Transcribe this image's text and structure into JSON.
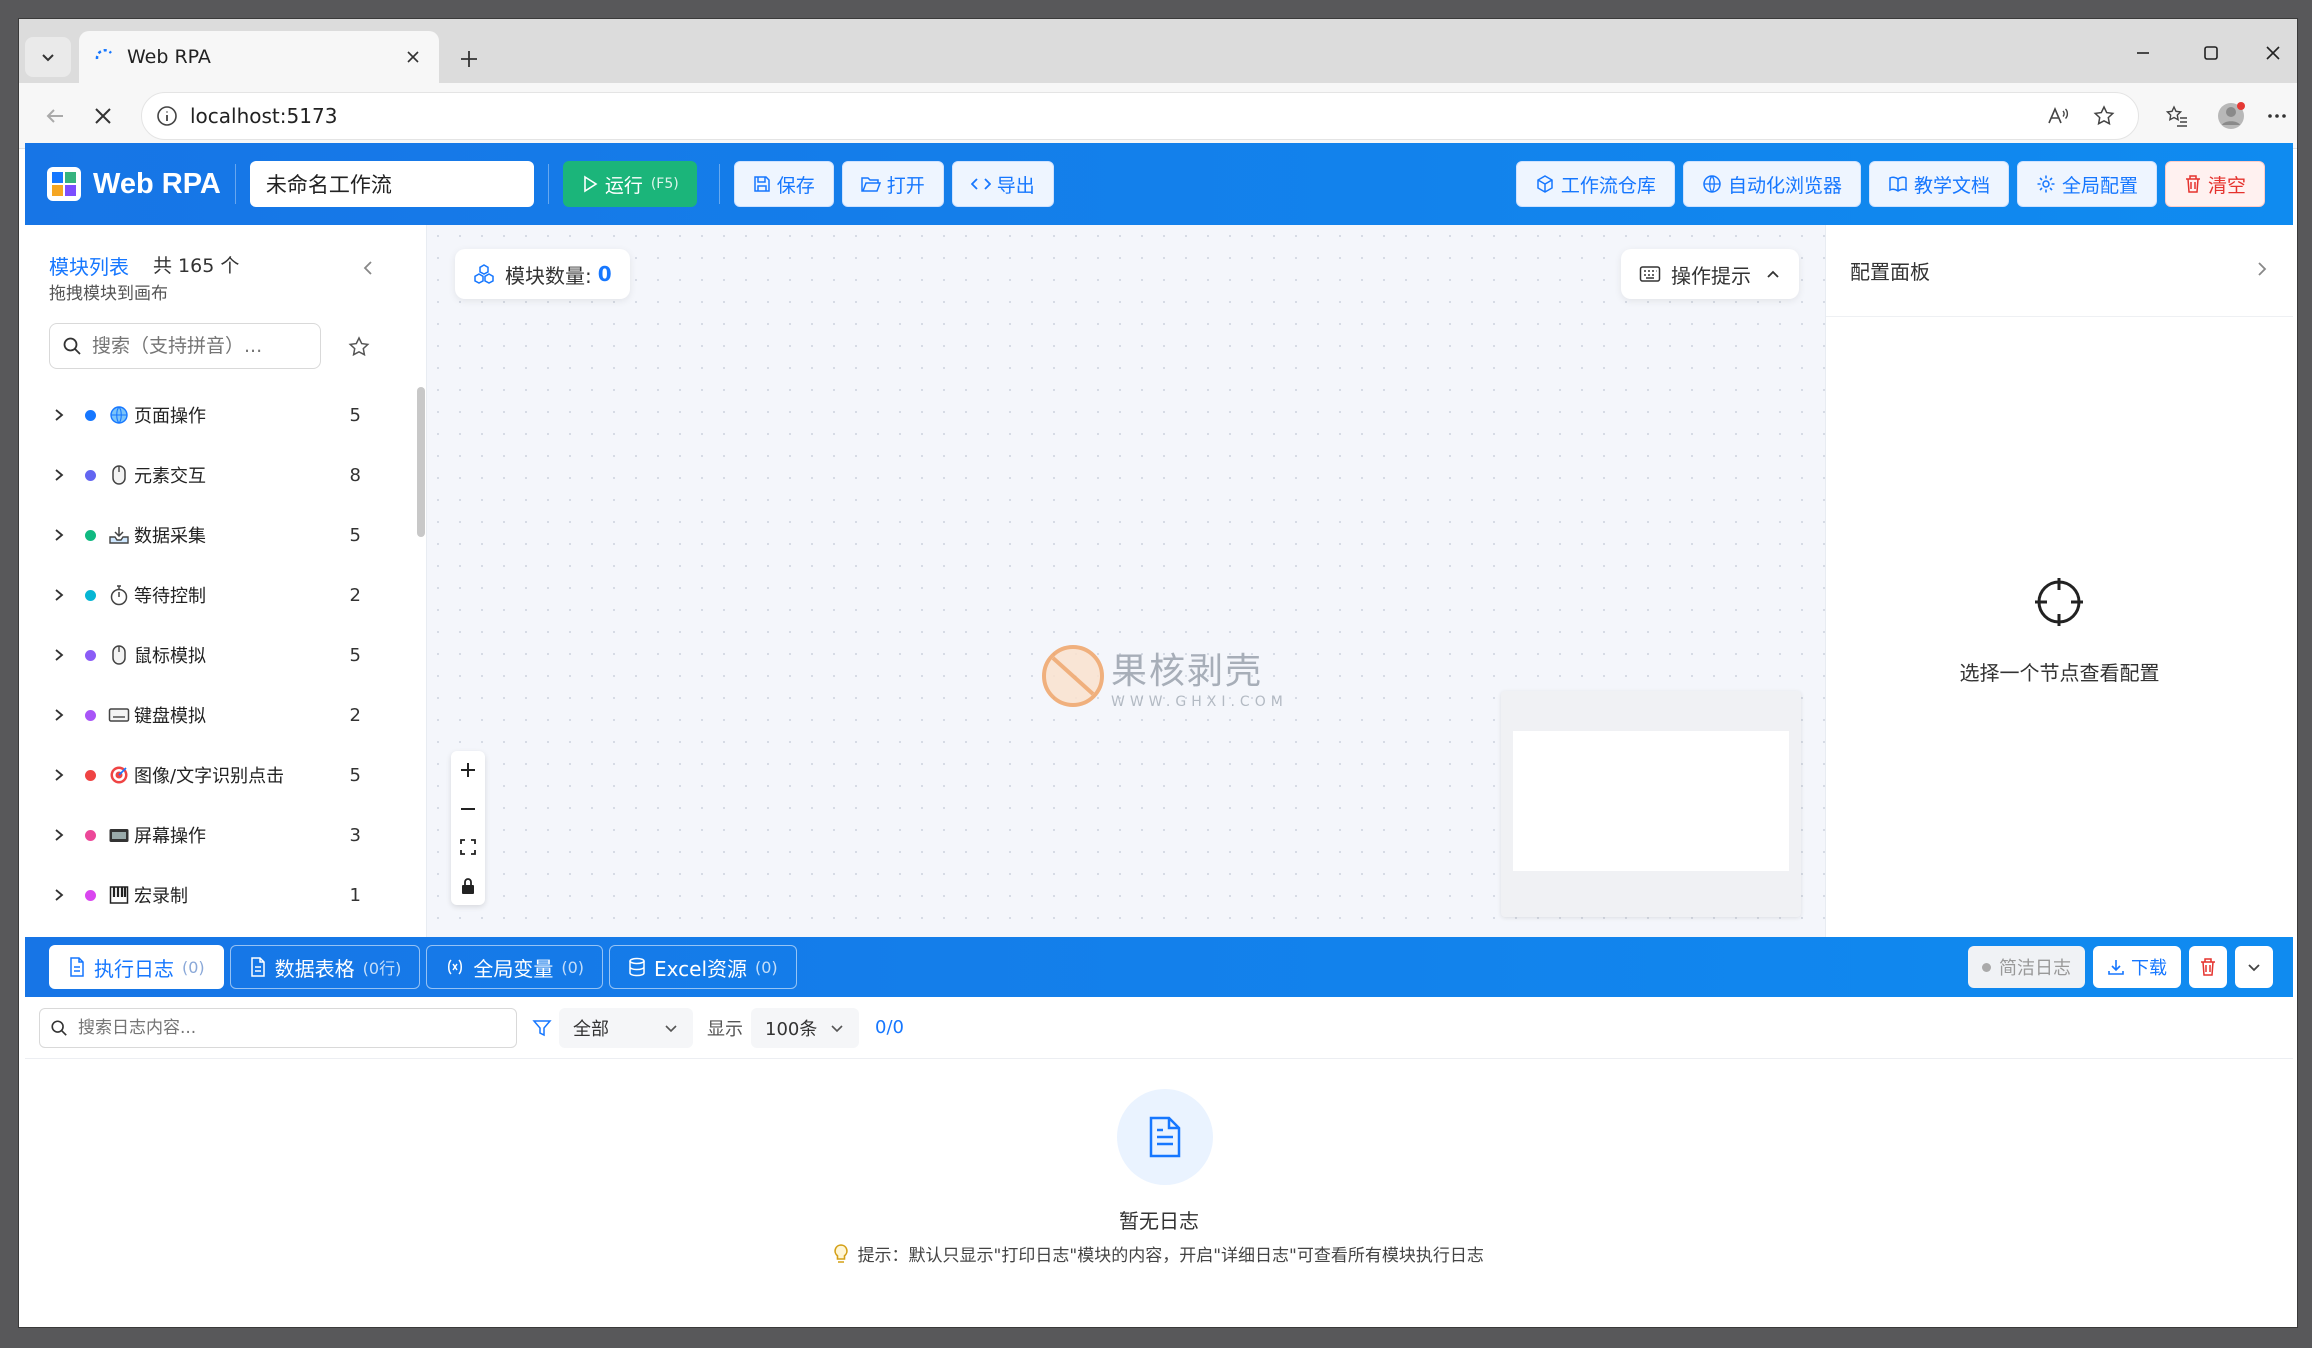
{
  "browser": {
    "tab_title": "Web RPA",
    "url": "localhost:5173"
  },
  "header": {
    "logo_text": "Web RPA",
    "workflow_name": "未命名工作流",
    "run_label": "运行",
    "run_shortcut": "(F5)",
    "save_label": "保存",
    "open_label": "打开",
    "export_label": "导出",
    "right_buttons": [
      "工作流仓库",
      "自动化浏览器",
      "教学文档",
      "全局配置",
      "清空"
    ]
  },
  "sidebar": {
    "title": "模块列表",
    "count_text": "共 165 个",
    "subtitle": "拖拽模块到画布",
    "search_placeholder": "搜索（支持拼音）...",
    "items": [
      {
        "label": "页面操作",
        "count": "5",
        "dot": "#1677ff",
        "icon": "globe-icon"
      },
      {
        "label": "元素交互",
        "count": "8",
        "dot": "#6366f1",
        "icon": "mouse-icon"
      },
      {
        "label": "数据采集",
        "count": "5",
        "dot": "#10b981",
        "icon": "tray-icon"
      },
      {
        "label": "等待控制",
        "count": "2",
        "dot": "#06b6d4",
        "icon": "stopwatch-icon"
      },
      {
        "label": "鼠标模拟",
        "count": "5",
        "dot": "#8b5cf6",
        "icon": "mouse-icon"
      },
      {
        "label": "键盘模拟",
        "count": "2",
        "dot": "#a855f7",
        "icon": "keyboard-icon"
      },
      {
        "label": "图像/文字识别点击",
        "count": "5",
        "dot": "#ef4444",
        "icon": "target-icon"
      },
      {
        "label": "屏幕操作",
        "count": "3",
        "dot": "#ec4899",
        "icon": "screen-icon"
      },
      {
        "label": "宏录制",
        "count": "1",
        "dot": "#d946ef",
        "icon": "piano-icon"
      }
    ]
  },
  "canvas": {
    "module_count_label": "模块数量:",
    "module_count": "0",
    "tips_label": "操作提示",
    "watermark_main": "果核剥壳",
    "watermark_sub": "WWW.GHXI.COM"
  },
  "config_panel": {
    "title": "配置面板",
    "empty_text": "选择一个节点查看配置"
  },
  "bottom_tabs": [
    {
      "label": "执行日志",
      "count": "(0)"
    },
    {
      "label": "数据表格",
      "count": "(0行)"
    },
    {
      "label": "全局变量",
      "count": "(0)"
    },
    {
      "label": "Excel资源",
      "count": "(0)"
    }
  ],
  "bottom_actions": {
    "simple_log": "简洁日志",
    "download": "下载"
  },
  "log_filter": {
    "search_placeholder": "搜索日志内容...",
    "level": "全部",
    "show_label": "显示",
    "page_size": "100条",
    "pager": "0/0"
  },
  "log_empty": {
    "title": "暂无日志",
    "tip": "提示：默认只显示\"打印日志\"模块的内容，开启\"详细日志\"可查看所有模块执行日志"
  },
  "colors": {
    "primary": "#1677ff",
    "run": "#1bb57a",
    "danger": "#e5322d"
  }
}
